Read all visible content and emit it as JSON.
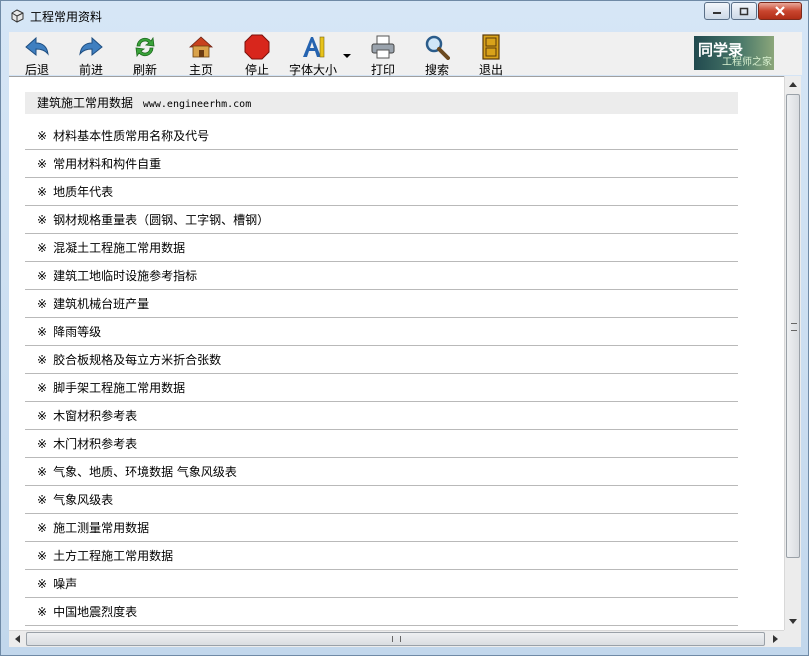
{
  "window": {
    "title": "工程常用资料"
  },
  "toolbar": {
    "back": "后退",
    "forward": "前进",
    "refresh": "刷新",
    "home": "主页",
    "stop": "停止",
    "font_size": "字体大小",
    "print": "打印",
    "search": "搜索",
    "exit": "退出"
  },
  "logo": {
    "main": "同学录",
    "sub": "工程师之家"
  },
  "content": {
    "header": "建筑施工常用数据",
    "url": "www.engineerhm.com",
    "marker": "※",
    "items": [
      "材料基本性质常用名称及代号",
      "常用材料和构件自重",
      "地质年代表",
      "钢材规格重量表（圆钢、工字钢、槽钢）",
      "混凝土工程施工常用数据",
      "建筑工地临时设施参考指标",
      "建筑机械台班产量",
      "降雨等级",
      "胶合板规格及每立方米折合张数",
      "脚手架工程施工常用数据",
      "木窗材积参考表",
      "木门材积参考表",
      "气象、地质、环境数据 气象风级表",
      "气象风级表",
      "施工测量常用数据",
      "土方工程施工常用数据",
      "噪声",
      "中国地震烈度表"
    ]
  },
  "colors": {
    "titlebar": "#c9dcef",
    "close": "#c9452e",
    "header_bg": "#ececec"
  }
}
